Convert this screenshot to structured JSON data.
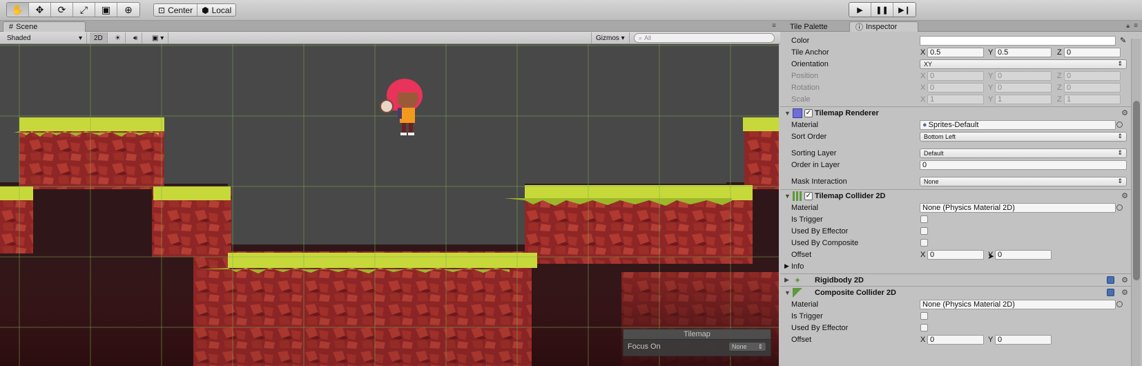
{
  "toolbar": {
    "transform_tools": [
      "hand-tool-icon",
      "move-tool-icon",
      "rotate-tool-icon",
      "scale-tool-icon",
      "rect-tool-icon",
      "transform-tool-icon"
    ],
    "pivot_label": "Center",
    "space_label": "Local",
    "play_controls": [
      "play-icon",
      "pause-icon",
      "step-icon"
    ]
  },
  "scene": {
    "tab_label": "Scene",
    "shading_mode": "Shaded",
    "mode_2d": "2D",
    "gizmos_label": "Gizmos",
    "search_placeholder": "All",
    "overlay_title": "Tilemap",
    "overlay_focus_label": "Focus On",
    "overlay_focus_value": "None"
  },
  "inspector": {
    "tabs": [
      "Tile Palette",
      "Inspector"
    ],
    "top_props": {
      "color_label": "Color",
      "tile_anchor_label": "Tile Anchor",
      "tile_anchor": {
        "x": "0.5",
        "y": "0.5",
        "z": "0"
      },
      "orientation_label": "Orientation",
      "orientation_value": "XY",
      "position_label": "Position",
      "position": {
        "x": "0",
        "y": "0",
        "z": "0"
      },
      "rotation_label": "Rotation",
      "rotation": {
        "x": "0",
        "y": "0",
        "z": "0"
      },
      "scale_label": "Scale",
      "scale": {
        "x": "1",
        "y": "1",
        "z": "1"
      }
    },
    "tilemap_renderer": {
      "name": "Tilemap Renderer",
      "material_label": "Material",
      "material_value": "Sprites-Default",
      "sort_order_label": "Sort Order",
      "sort_order_value": "Bottom Left",
      "sorting_layer_label": "Sorting Layer",
      "sorting_layer_value": "Default",
      "order_in_layer_label": "Order in Layer",
      "order_in_layer_value": "0",
      "mask_interaction_label": "Mask Interaction",
      "mask_interaction_value": "None"
    },
    "tilemap_collider": {
      "name": "Tilemap Collider 2D",
      "material_label": "Material",
      "material_value": "None (Physics Material 2D)",
      "is_trigger_label": "Is Trigger",
      "used_by_effector_label": "Used By Effector",
      "used_by_composite_label": "Used By Composite",
      "offset_label": "Offset",
      "offset": {
        "x": "0",
        "y": "0"
      },
      "info_label": "Info"
    },
    "rigidbody": {
      "name": "Rigidbody 2D"
    },
    "composite_collider": {
      "name": "Composite Collider 2D",
      "material_label": "Material",
      "material_value": "None (Physics Material 2D)",
      "is_trigger_label": "Is Trigger",
      "used_by_effector_label": "Used By Effector",
      "offset_label": "Offset",
      "offset": {
        "x": "0",
        "y": "0"
      }
    },
    "axis_labels": {
      "x": "X",
      "y": "Y",
      "z": "Z"
    }
  }
}
